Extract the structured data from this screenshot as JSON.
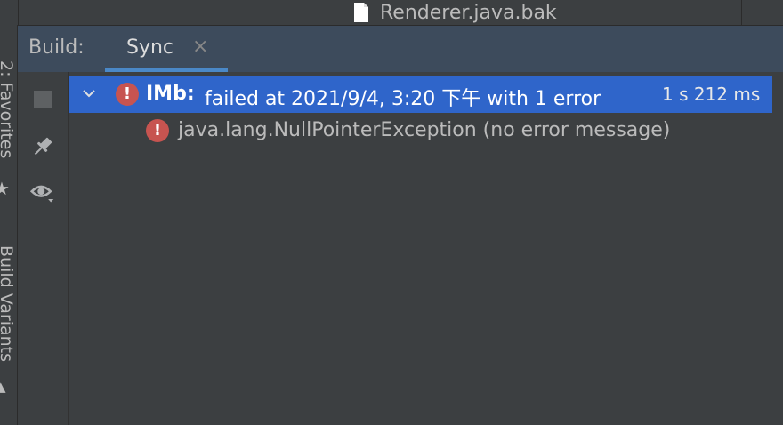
{
  "file_tree": {
    "file_name": "Renderer.java.bak"
  },
  "side_strip": {
    "favorites_label": "2: Favorites",
    "build_variants_label": "Build Variants"
  },
  "header": {
    "label": "Build:",
    "tab_label": "Sync",
    "tab_close": "×"
  },
  "toolbar": {
    "stop_icon": "stop-icon",
    "pin_icon": "pin-icon",
    "eye_icon": "eye-icon"
  },
  "tree": {
    "root": {
      "name": "IMb:",
      "message": "failed at 2021/9/4, 3:20 下午 with 1 error",
      "duration": "1 s 212 ms",
      "status": "error"
    },
    "child": {
      "message": "java.lang.NullPointerException (no error message)",
      "status": "error"
    }
  },
  "colors": {
    "selection": "#2f65ca",
    "error": "#c75450",
    "accent": "#4a88c7",
    "header": "#3d4b5c"
  }
}
